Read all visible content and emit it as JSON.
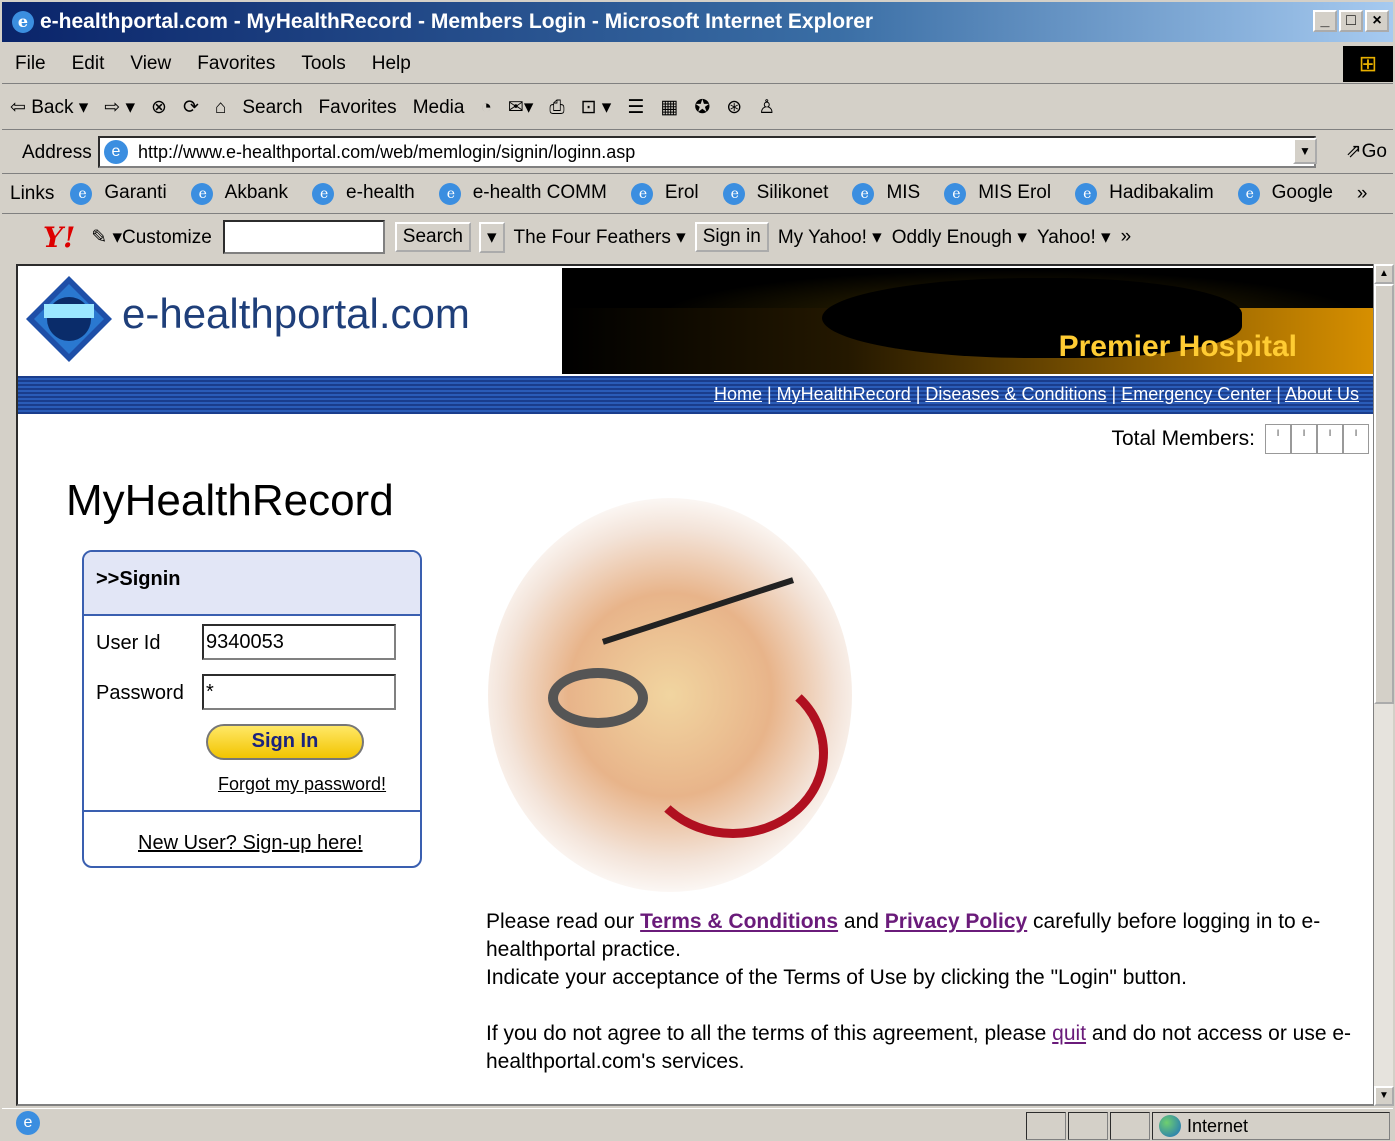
{
  "window": {
    "title": "e-healthportal.com - MyHealthRecord - Members Login - Microsoft Internet Explorer"
  },
  "menu": [
    "File",
    "Edit",
    "View",
    "Favorites",
    "Tools",
    "Help"
  ],
  "toolbar": {
    "back": "⇦ Back ▾",
    "forward": "⇨ ▾",
    "stop": "⊗",
    "refresh": "⟳",
    "home": "⌂",
    "search": "Search",
    "favorites": "Favorites",
    "media": "Media",
    "history": "◔",
    "mail": "✉▾",
    "print": "⎙",
    "edit": "⊡ ▾",
    "discuss": "☰",
    "messenger": "▦",
    "extra1": "✪",
    "extra2": "⊛",
    "extra3": "♙"
  },
  "address": {
    "label": "Address",
    "url": "http://www.e-healthportal.com/web/memlogin/signin/loginn.asp",
    "go": "⇗Go"
  },
  "links": {
    "label": "Links",
    "items": [
      "Garanti",
      "Akbank",
      "e-health",
      "e-health COMM",
      "Erol",
      "Silikonet",
      "MIS",
      "MIS Erol",
      "Hadibakalim",
      "Google"
    ],
    "more": "»"
  },
  "yahoo": {
    "logo": "Y!",
    "customize": "✎ ▾Customize",
    "search_btn": "Search",
    "search_dd": "▾",
    "feathers": "The Four Feathers ▾",
    "signin": "Sign in",
    "myyahoo": "My Yahoo! ▾",
    "oddly": "Oddly Enough ▾",
    "yahoo": "Yahoo! ▾",
    "more": "»"
  },
  "site": {
    "brand": "e-healthportal.com",
    "banner_text": "Premier Hospital",
    "nav": [
      "Home",
      "MyHealthRecord",
      "Diseases & Conditions",
      "Emergency Center",
      "About Us"
    ],
    "nav_sep": " | ",
    "members_label": "Total Members:",
    "members_digits": [
      "ı",
      "ı",
      "ı",
      "ı"
    ],
    "page_title": "MyHealthRecord"
  },
  "signin": {
    "header": ">>Signin",
    "userid_label": "User Id",
    "userid_value": "9340053",
    "password_label": "Password",
    "password_value": "*",
    "button": "Sign In",
    "forgot": "Forgot my password!",
    "newuser": "New User? Sign-up here!"
  },
  "terms": {
    "p1_a": "Please read our ",
    "terms_link": "Terms & Conditions",
    "p1_b": " and ",
    "privacy_link": "Privacy Policy",
    "p1_c": " carefully before logging in to e-healthportal practice.",
    "p2": "Indicate your acceptance of the Terms of Use by clicking the \"Login\" button.",
    "p3_a": "If you do not agree to all the terms of this agreement, please ",
    "quit_link": "quit",
    "p3_b": " and do not access or use e-healthportal.com's services."
  },
  "status": {
    "zone": "Internet"
  }
}
